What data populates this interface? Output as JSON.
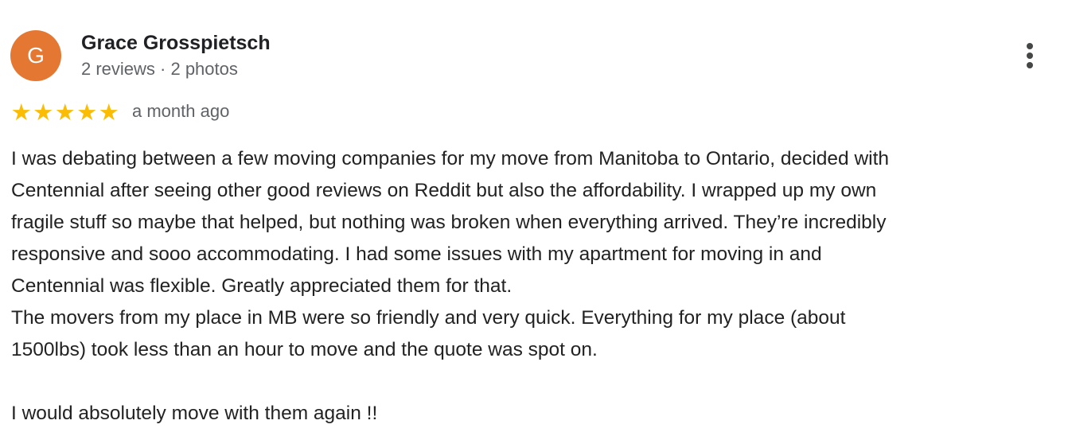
{
  "reviewer": {
    "initial": "G",
    "name": "Grace Grosspietsch",
    "meta": "2 reviews · 2 photos",
    "avatar_color": "#e47833"
  },
  "menu": {
    "icon": "more-vert-icon"
  },
  "rating": {
    "stars": 5,
    "max": 5,
    "star_color": "#fbbc04",
    "date": "a month ago"
  },
  "review": {
    "lines": [
      "I was debating between a few moving companies for my move from Manitoba to Ontario, decided with",
      "Centennial after seeing other good reviews on Reddit but also the affordability. I wrapped up my own",
      "fragile stuff so maybe that helped, but nothing was broken when everything arrived. They’re incredibly",
      "responsive and sooo accommodating. I had some issues with my apartment for moving in and",
      "Centennial was flexible. Greatly appreciated them for that.",
      "The movers from my place in MB were so friendly and very quick. Everything for my place (about",
      "1500lbs) took less than an hour to move and the quote was spot on.",
      "",
      "I would absolutely move with them again !!"
    ]
  }
}
